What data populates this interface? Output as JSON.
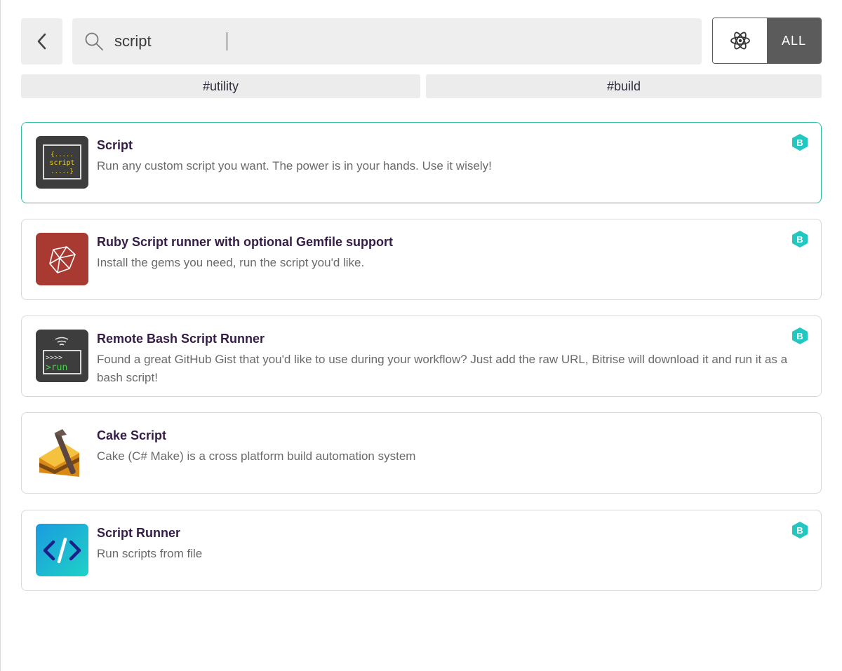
{
  "search": {
    "value": "script",
    "placeholder": ""
  },
  "filter_toggle": {
    "all_label": "ALL"
  },
  "tags": [
    "#utility",
    "#build"
  ],
  "colors": {
    "accent_teal": "#2fc29a",
    "badge": "#21c7c0",
    "toggle_active": "#5b5b5b"
  },
  "steps": [
    {
      "title": "Script",
      "description": "Run any custom script you want. The power is in your hands. Use it wisely!",
      "icon_text": [
        "{.....",
        "script",
        ".....}"
      ],
      "badge": "B"
    },
    {
      "title": "Ruby Script runner with optional Gemfile support",
      "description": "Install the gems you need, run the script you'd like.",
      "badge": "B"
    },
    {
      "title": "Remote Bash Script Runner",
      "description": "Found a great GitHub Gist that you'd like to use during your workflow? Just add the raw URL, Bitrise will download it and run it as a bash script!",
      "icon_text": [
        ">>>>",
        ">run"
      ],
      "badge": "B"
    },
    {
      "title": "Cake Script",
      "description": "Cake (C# Make) is a cross platform build automation system"
    },
    {
      "title": "Script Runner",
      "description": "Run scripts from file",
      "badge": "B"
    }
  ]
}
